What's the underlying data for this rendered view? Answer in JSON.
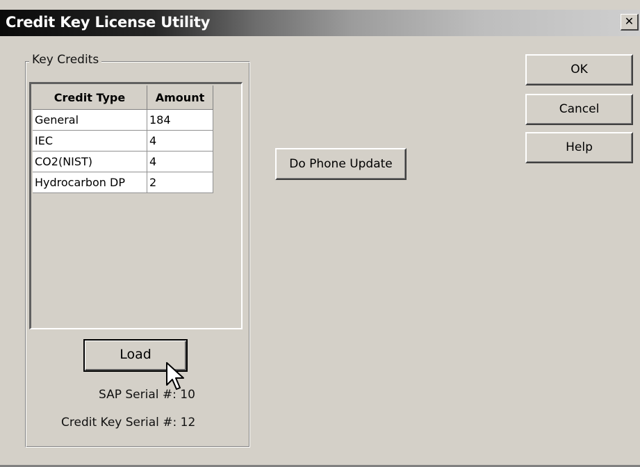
{
  "window": {
    "title": "Credit Key License Utility",
    "close_glyph": "✕"
  },
  "group": {
    "title": "Key Credits"
  },
  "grid": {
    "columns": [
      "Credit Type",
      "Amount"
    ],
    "rows": [
      {
        "type": "General",
        "amount": "184"
      },
      {
        "type": "IEC",
        "amount": "4"
      },
      {
        "type": "CO2(NIST)",
        "amount": "4"
      },
      {
        "type": "Hydrocarbon DP",
        "amount": "2"
      }
    ]
  },
  "buttons": {
    "load": "Load",
    "phone_update": "Do Phone Update",
    "ok": "OK",
    "cancel": "Cancel",
    "help": "Help"
  },
  "info": {
    "sap_serial": "SAP Serial #: 10",
    "credit_key_serial": "Credit Key Serial #: 12"
  },
  "icons": {
    "cursor": "mouse-pointer-icon"
  }
}
